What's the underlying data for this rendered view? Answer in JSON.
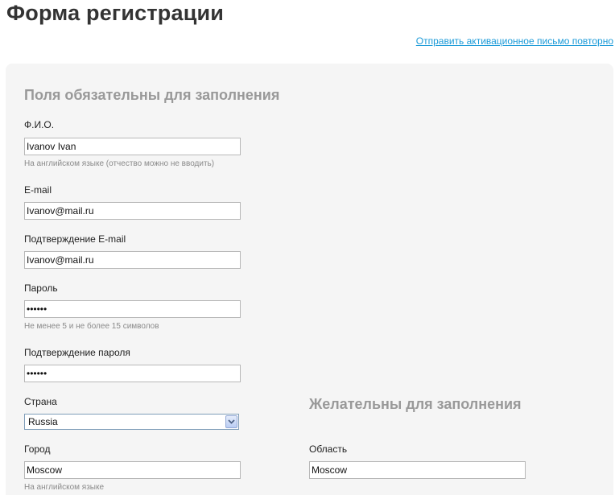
{
  "page": {
    "title": "Форма регистрации",
    "resend_link": "Отправить активационное письмо повторно"
  },
  "required_section": {
    "title": "Поля обязательны для заполнения",
    "fio": {
      "label": "Ф.И.О.",
      "value": "Ivanov Ivan",
      "hint": "На английском языке (отчество можно не вводить)"
    },
    "email": {
      "label": "E-mail",
      "value": "Ivanov@mail.ru"
    },
    "email_confirm": {
      "label": "Подтверждение E-mail",
      "value": "Ivanov@mail.ru"
    },
    "password": {
      "label": "Пароль",
      "value": "••••••",
      "hint": "Не менее 5 и не более 15 символов"
    },
    "password_confirm": {
      "label": "Подтверждение пароля",
      "value": "••••••"
    },
    "country": {
      "label": "Страна",
      "selected": "Russia"
    },
    "city": {
      "label": "Город",
      "value": "Moscow",
      "hint": "На английском языке"
    }
  },
  "optional_section": {
    "title": "Желательны для заполнения",
    "region": {
      "label": "Область",
      "value": "Moscow"
    }
  },
  "colors": {
    "link": "#1a9ad8",
    "panel_background": "#f5f5f5",
    "section_title": "#999999",
    "hint": "#8a8a8a"
  },
  "icons": {
    "select_arrow": "chevron-down-icon"
  }
}
